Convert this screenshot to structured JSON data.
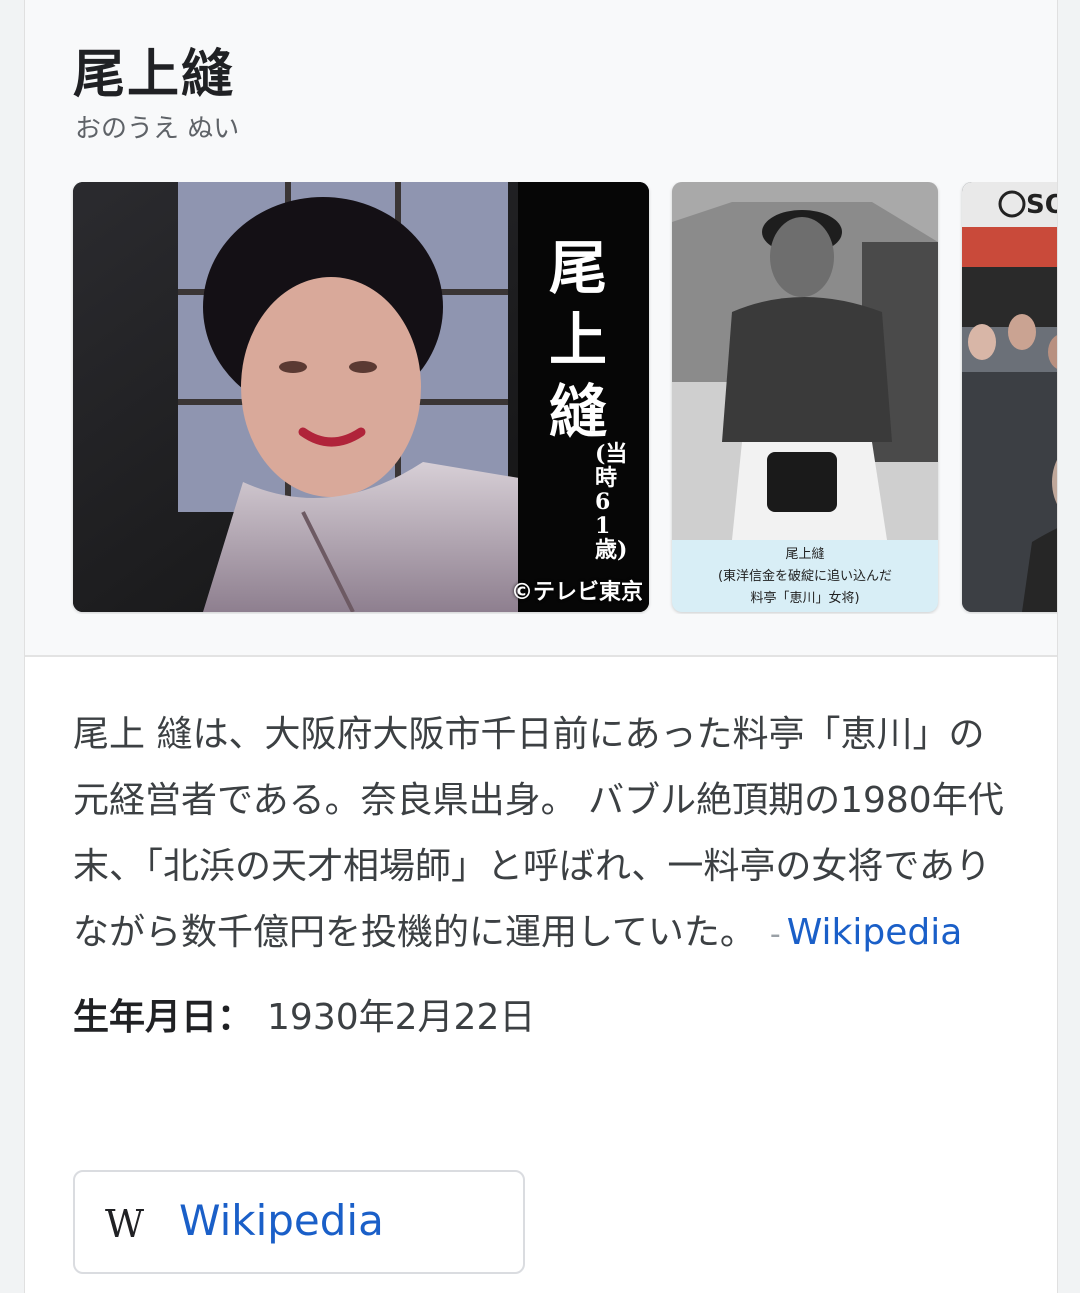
{
  "entity": {
    "name": "尾上縫",
    "reading": "おのうえ ぬい"
  },
  "images": {
    "image1_vertical_caption": [
      "尾",
      "上",
      "縫"
    ],
    "image1_age": "(当時61歳)",
    "image1_watermark": "©テレビ東京",
    "image2_caption_lines": [
      "尾上縫",
      "(東洋信金を破綻に追い込んだ",
      "料亭「恵川」女将)"
    ],
    "image3_sign": "SO"
  },
  "description": {
    "text": "尾上 縫は、大阪府大阪市千日前にあった料亭「恵川」の元経営者である。奈良県出身。 バブル絶頂期の1980年代末、「北浜の天才相場師」と呼ばれ、一料亭の女将でありながら数千億円を投機的に運用していた。",
    "source_dash": "-",
    "source_link": "Wikipedia"
  },
  "facts": {
    "birth_label": "生年月日：",
    "birth_value": "1930年2月22日"
  },
  "wiki_button": {
    "logo": "W",
    "label": "Wikipedia"
  },
  "colors": {
    "link": "#1a5fc8",
    "header_bg": "#f8f9fa"
  }
}
